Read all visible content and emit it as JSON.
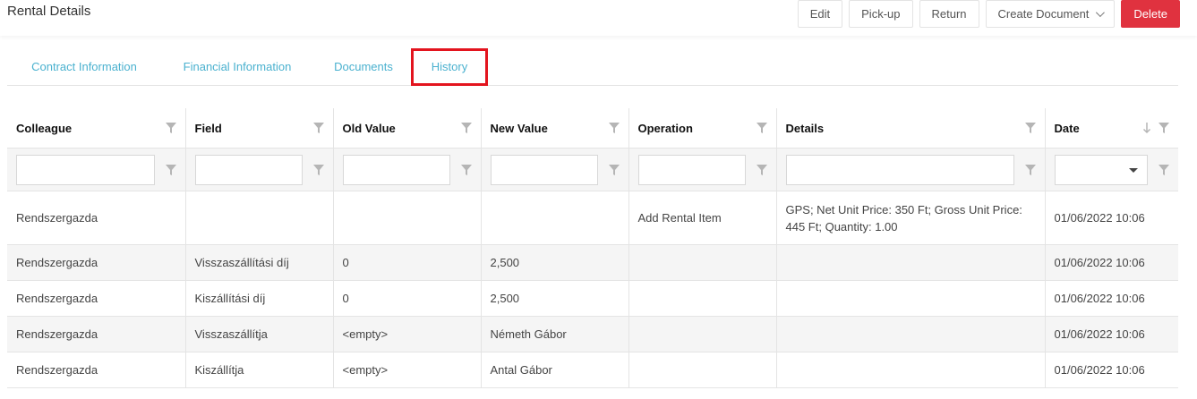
{
  "page": {
    "title": "Rental Details"
  },
  "toolbar": {
    "edit": "Edit",
    "pickup": "Pick-up",
    "return": "Return",
    "create_document": "Create Document",
    "delete": "Delete",
    "delete_color": "#e0323f"
  },
  "tabs": [
    {
      "label": "Contract Information"
    },
    {
      "label": "Financial Information"
    },
    {
      "label": "Documents"
    },
    {
      "label": "History",
      "active": true
    }
  ],
  "history": {
    "columns": [
      "Colleague",
      "Field",
      "Old Value",
      "New Value",
      "Operation",
      "Details",
      "Date"
    ],
    "rows": [
      {
        "colleague": "Rendszergazda",
        "field": "",
        "old": "",
        "new": "",
        "operation": "Add Rental Item",
        "details": "GPS; Net Unit Price: 350 Ft; Gross Unit Price: 445 Ft; Quantity: 1.00",
        "date": "01/06/2022 10:06"
      },
      {
        "colleague": "Rendszergazda",
        "field": "Visszaszállítási díj",
        "old": "0",
        "new": "2,500",
        "operation": "",
        "details": "",
        "date": "01/06/2022 10:06"
      },
      {
        "colleague": "Rendszergazda",
        "field": "Kiszállítási díj",
        "old": "0",
        "new": "2,500",
        "operation": "",
        "details": "",
        "date": "01/06/2022 10:06"
      },
      {
        "colleague": "Rendszergazda",
        "field": "Visszaszállítja",
        "old": "<empty>",
        "new": "Németh Gábor",
        "operation": "",
        "details": "",
        "date": "01/06/2022 10:06"
      },
      {
        "colleague": "Rendszergazda",
        "field": "Kiszállítja",
        "old": "<empty>",
        "new": "Antal Gábor",
        "operation": "",
        "details": "",
        "date": "01/06/2022 10:06"
      }
    ]
  }
}
